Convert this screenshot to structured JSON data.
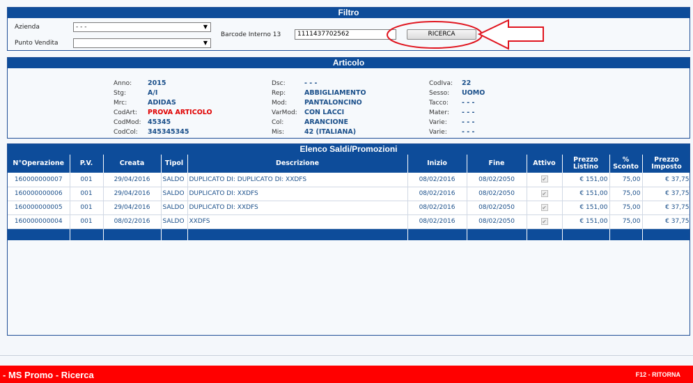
{
  "filtro": {
    "title": "Filtro",
    "azienda_label": "Azienda",
    "azienda_value": "- - -",
    "punto_vendita_label": "Punto Vendita",
    "punto_vendita_value": "",
    "barcode_label": "Barcode Interno 13",
    "barcode_value": "1111437702562",
    "ricerca_label": "RICERCA"
  },
  "articolo": {
    "title": "Articolo",
    "col1": [
      {
        "k": "Anno:",
        "v": "2015"
      },
      {
        "k": "Stg:",
        "v": "A/I"
      },
      {
        "k": "Mrc:",
        "v": "ADIDAS"
      },
      {
        "k": "CodArt:",
        "v": "PROVA ARTICOLO"
      },
      {
        "k": "CodMod:",
        "v": "45345"
      },
      {
        "k": "CodCol:",
        "v": "345345345"
      }
    ],
    "col2": [
      {
        "k": "Dsc:",
        "v": "- - -"
      },
      {
        "k": "Rep:",
        "v": "ABBIGLIAMENTO"
      },
      {
        "k": "Mod:",
        "v": "PANTALONCINO"
      },
      {
        "k": "VarMod:",
        "v": "CON LACCI"
      },
      {
        "k": "Col:",
        "v": "ARANCIONE"
      },
      {
        "k": "Mis:",
        "v": "42 (ITALIANA)"
      }
    ],
    "col3": [
      {
        "k": "CodIva:",
        "v": "22"
      },
      {
        "k": "Sesso:",
        "v": "UOMO"
      },
      {
        "k": "Tacco:",
        "v": "- - -"
      },
      {
        "k": "Mater:",
        "v": "- - -"
      },
      {
        "k": "Varie:",
        "v": "- - -"
      },
      {
        "k": "Varie:",
        "v": "- - -"
      }
    ]
  },
  "elenco": {
    "title": "Elenco Saldi/Promozioni",
    "headers": {
      "op": "N°Operazione",
      "pv": "P.V.",
      "creata": "Creata",
      "tipol": "Tipol",
      "descrizione": "Descrizione",
      "inizio": "Inizio",
      "fine": "Fine",
      "attivo": "Attivo",
      "prezzo_listino_1": "Prezzo",
      "prezzo_listino_2": "Listino",
      "sconto_1": "%",
      "sconto_2": "Sconto",
      "prezzo_imposto_1": "Prezzo",
      "prezzo_imposto_2": "Imposto"
    },
    "rows": [
      {
        "op": "160000000007",
        "pv": "001",
        "creata": "29/04/2016",
        "tipol": "SALDO",
        "descrizione": "DUPLICATO DI: DUPLICATO DI: XXDFS",
        "inizio": "08/02/2016",
        "fine": "08/02/2050",
        "attivo": "✔",
        "listino": "€ 151,00",
        "sconto": "75,00",
        "imposto": "€ 37,75"
      },
      {
        "op": "160000000006",
        "pv": "001",
        "creata": "29/04/2016",
        "tipol": "SALDO",
        "descrizione": "DUPLICATO DI: XXDFS",
        "inizio": "08/02/2016",
        "fine": "08/02/2050",
        "attivo": "✔",
        "listino": "€ 151,00",
        "sconto": "75,00",
        "imposto": "€ 37,75"
      },
      {
        "op": "160000000005",
        "pv": "001",
        "creata": "29/04/2016",
        "tipol": "SALDO",
        "descrizione": "DUPLICATO DI: XXDFS",
        "inizio": "08/02/2016",
        "fine": "08/02/2050",
        "attivo": "✔",
        "listino": "€ 151,00",
        "sconto": "75,00",
        "imposto": "€ 37,75"
      },
      {
        "op": "160000000004",
        "pv": "001",
        "creata": "08/02/2016",
        "tipol": "SALDO",
        "descrizione": "XXDFS",
        "inizio": "08/02/2016",
        "fine": "08/02/2050",
        "attivo": "✔",
        "listino": "€ 151,00",
        "sconto": "75,00",
        "imposto": "€ 37,75"
      }
    ]
  },
  "footer": {
    "title": "- MS Promo - Ricerca",
    "shortcut": "F12 - RITORNA"
  },
  "colors": {
    "header_blue": "#0d4c9a",
    "value_blue": "#1a4f8a",
    "accent_red": "#ff0000",
    "annotation_red": "#e0141e"
  }
}
